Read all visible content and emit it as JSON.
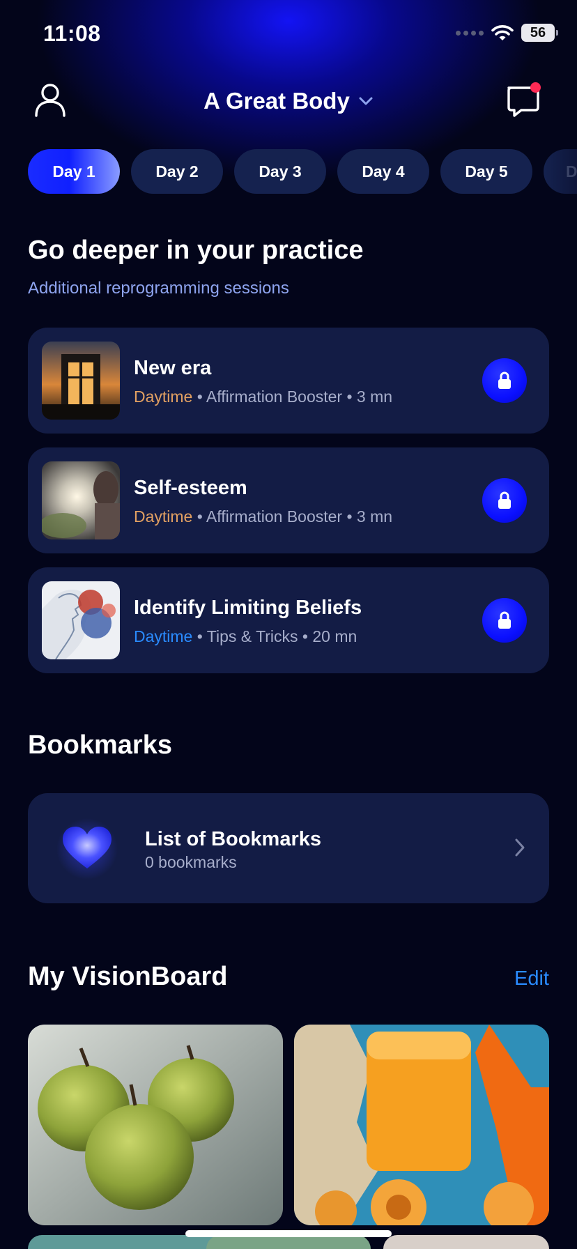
{
  "status_bar": {
    "time": "11:08",
    "battery": "56"
  },
  "header": {
    "title": "A Great Body"
  },
  "days": [
    "Day 1",
    "Day 2",
    "Day 3",
    "Day 4",
    "Day 5",
    "D"
  ],
  "deeper": {
    "title": "Go deeper in your practice",
    "subtitle": "Additional reprogramming sessions",
    "sessions": [
      {
        "title": "New era",
        "tag": "Daytime",
        "meta": " • Affirmation Booster • 3 mn"
      },
      {
        "title": "Self-esteem",
        "tag": "Daytime",
        "meta": " • Affirmation Booster • 3 mn"
      },
      {
        "title": "Identify Limiting Beliefs",
        "tag": "Daytime",
        "meta": " • Tips & Tricks • 20 mn"
      }
    ]
  },
  "bookmarks": {
    "title": "Bookmarks",
    "list_title": "List of Bookmarks",
    "count": "0 bookmarks"
  },
  "visionboard": {
    "title": "My VisionBoard",
    "edit": "Edit"
  },
  "colors": {
    "accent": "#1020ff",
    "tag_orange": "#e2a062",
    "tag_blue": "#2a8bff",
    "card_bg": "#131c45",
    "badge_red": "#ff2a55"
  }
}
